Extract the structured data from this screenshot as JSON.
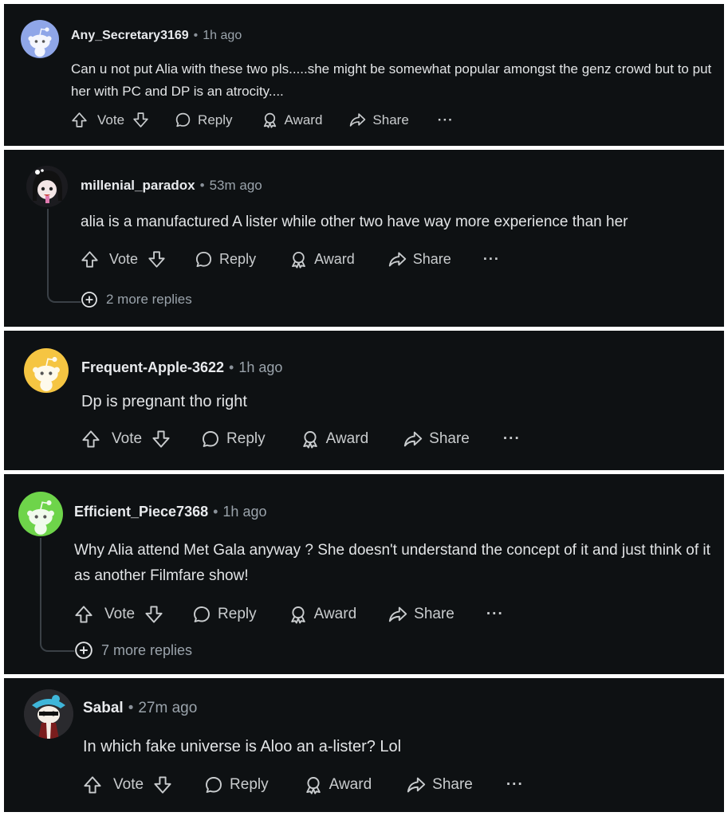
{
  "labels": {
    "vote": "Vote",
    "reply": "Reply",
    "award": "Award",
    "share": "Share",
    "more": "···",
    "separator": "•"
  },
  "comments": [
    {
      "username": "Any_Secretary3169",
      "time": "1h ago",
      "text": "Can u not put Alia with these two pls.....she might be somewhat popular amongst the genz crowd but to put her with PC and DP is an atrocity....",
      "avatar": "default-snoo-avatar",
      "avatar_color": "#8fa6e8"
    },
    {
      "username": "millenial_paradox",
      "time": "53m ago",
      "text": "alia is a manufactured A lister while other two have way more experience than her",
      "avatar": "anime-girl-avatar",
      "more_replies": "2 more replies"
    },
    {
      "username": "Frequent-Apple-3622",
      "time": "1h ago",
      "text": "Dp is pregnant tho right",
      "avatar": "default-snoo-avatar",
      "avatar_color": "#f5c542"
    },
    {
      "username": "Efficient_Piece7368",
      "time": "1h ago",
      "text": "Why Alia attend Met Gala anyway ? She doesn't understand the concept of it and just think of it as another Filmfare show!",
      "avatar": "default-snoo-avatar",
      "avatar_color": "#6ed44a",
      "more_replies": "7 more replies"
    },
    {
      "username": "Sabal",
      "time": "27m ago",
      "text": "In which fake universe is Aloo an a-lister? Lol",
      "avatar": "custom-snoo-avatar"
    }
  ]
}
